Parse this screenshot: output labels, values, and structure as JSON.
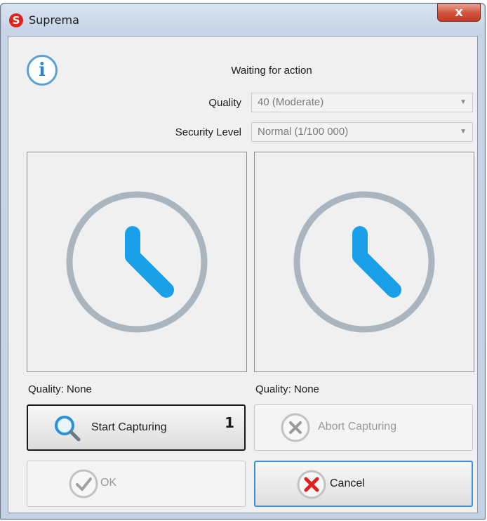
{
  "window": {
    "title": "Suprema",
    "close_glyph": "x"
  },
  "status": {
    "icon": "info-icon",
    "message": "Waiting for action"
  },
  "settings": {
    "quality_label": "Quality",
    "quality_value": "40 (Moderate)",
    "security_label": "Security Level",
    "security_value": "Normal (1/100 000)"
  },
  "panels": [
    {
      "icon": "clock-icon",
      "quality_text": "Quality: None"
    },
    {
      "icon": "clock-icon",
      "quality_text": "Quality: None"
    }
  ],
  "buttons": {
    "start_label": "Start Capturing",
    "start_badge": "1",
    "abort_label": "Abort Capturing",
    "ok_label": "OK",
    "cancel_label": "Cancel"
  },
  "colors": {
    "clock_ring": "#a9b6bf",
    "clock_hands": "#1aa0e8",
    "cancel_x": "#e02020",
    "focus_border": "#3c8fd6"
  }
}
